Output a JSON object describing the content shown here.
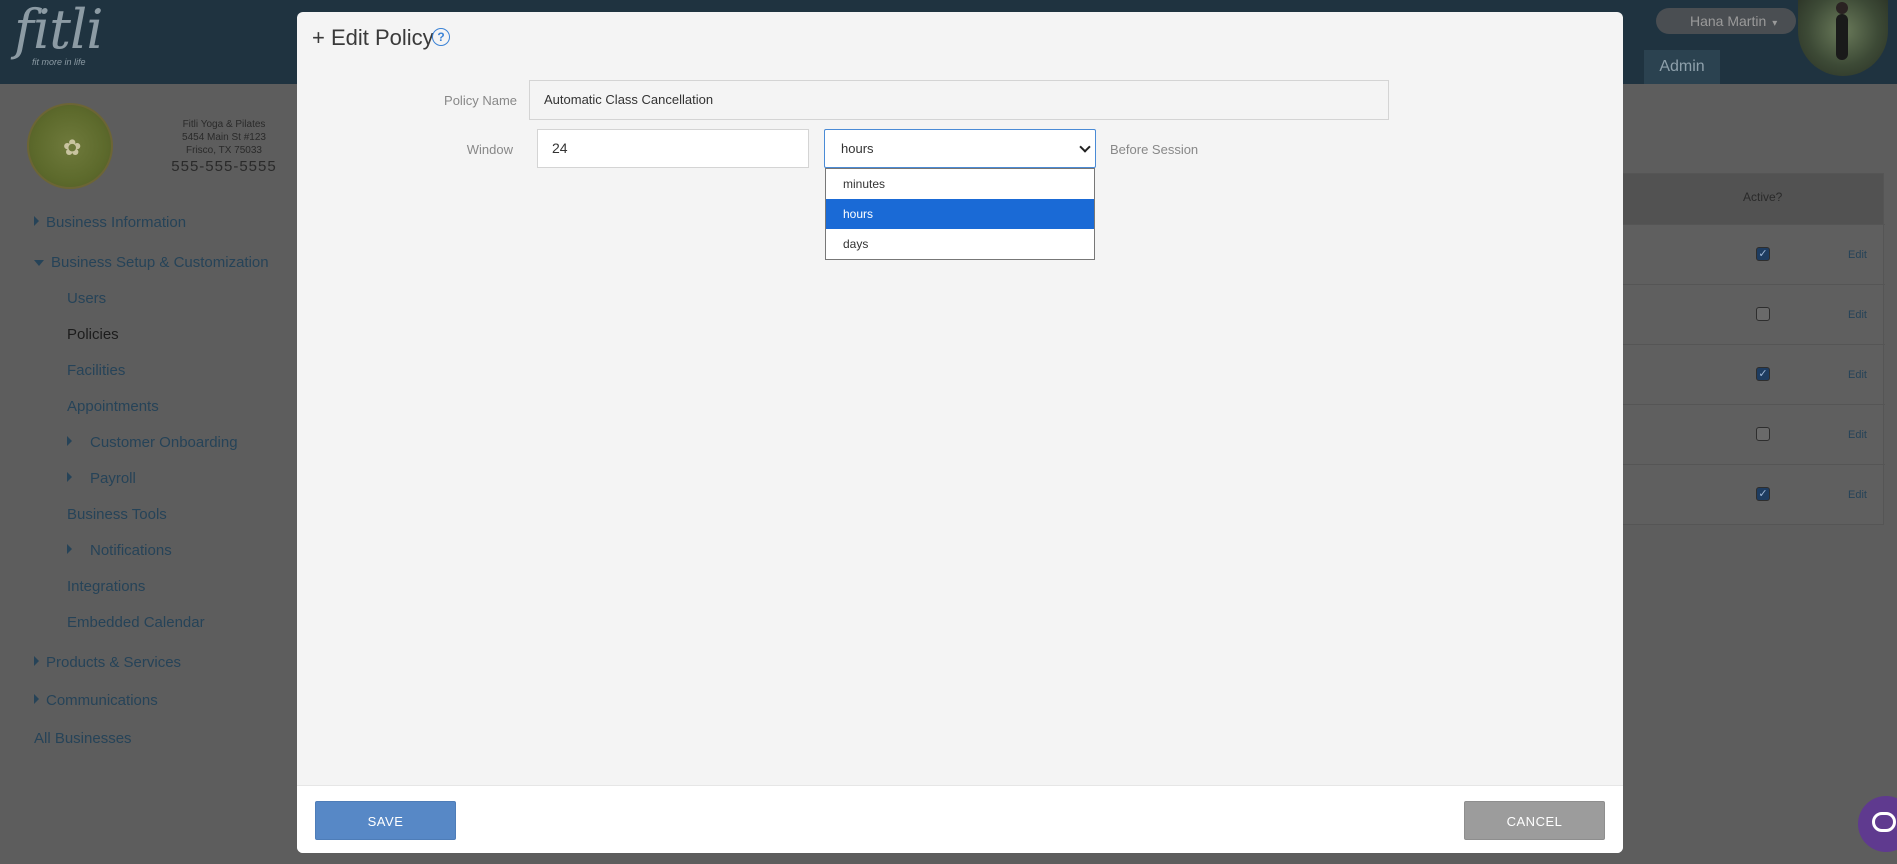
{
  "app": {
    "logo_text": "fitli",
    "logo_tagline": "fit more in life",
    "user_name": "Hana Martin",
    "admin_tab": "Admin"
  },
  "business": {
    "name": "Fitli Yoga & Pilates",
    "address1": "5454 Main St #123",
    "address2": "Frisco, TX 75033",
    "phone": "555-555-5555"
  },
  "sidebar": {
    "items": [
      {
        "label": "Business Information"
      },
      {
        "label": "Business Setup & Customization"
      },
      {
        "label": "Users"
      },
      {
        "label": "Policies"
      },
      {
        "label": "Facilities"
      },
      {
        "label": "Appointments"
      },
      {
        "label": "Customer Onboarding"
      },
      {
        "label": "Payroll"
      },
      {
        "label": "Business Tools"
      },
      {
        "label": "Notifications"
      },
      {
        "label": "Integrations"
      },
      {
        "label": "Embedded Calendar"
      },
      {
        "label": "Products & Services"
      },
      {
        "label": "Communications"
      },
      {
        "label": "All Businesses"
      }
    ]
  },
  "bg_table": {
    "active_header": "Active?",
    "edit_label": "Edit",
    "rows": [
      {
        "active": true
      },
      {
        "active": false
      },
      {
        "active": true
      },
      {
        "active": false
      },
      {
        "active": true
      }
    ]
  },
  "modal": {
    "title": "+ Edit Policy",
    "help_icon": "?",
    "policy_name_label": "Policy Name",
    "policy_name_value": "Automatic Class Cancellation",
    "window_label": "Window",
    "window_value": "24",
    "unit_selected": "hours",
    "unit_options": [
      "minutes",
      "hours",
      "days"
    ],
    "before_label": "Before Session",
    "save_label": "SAVE",
    "cancel_label": "CANCEL"
  },
  "colors": {
    "accent": "#5788c6",
    "selected_option": "#1a6ad6",
    "help": "#3c83d6"
  }
}
